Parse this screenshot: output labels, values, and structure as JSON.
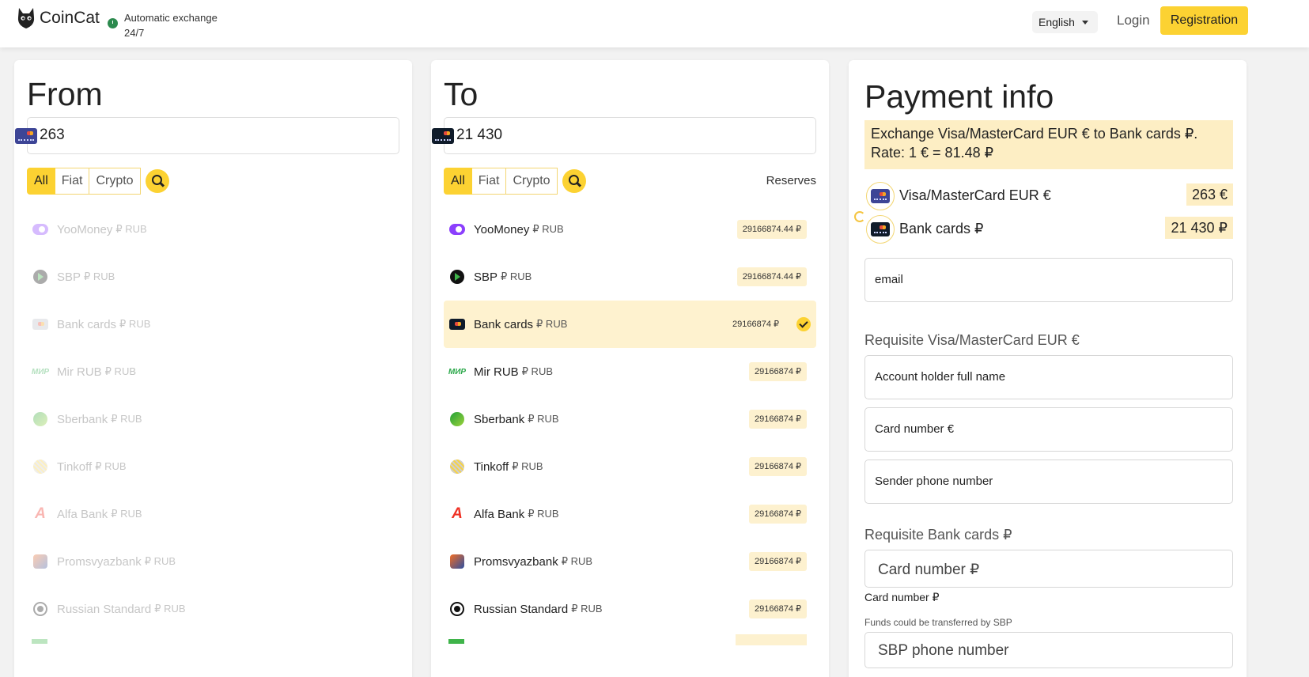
{
  "header": {
    "logo_text": "CoinCat",
    "tagline_line1": "Automatic exchange",
    "tagline_line2": "24/7",
    "language": "English",
    "login": "Login",
    "registration": "Registration"
  },
  "from": {
    "title": "From",
    "amount": "263",
    "filters": [
      "All",
      "Fiat",
      "Crypto"
    ],
    "active_filter": "All",
    "items": [
      {
        "name": "YooMoney",
        "currency": "₽ RUB",
        "icon": "yoomoney-icon"
      },
      {
        "name": "SBP",
        "currency": "₽ RUB",
        "icon": "sbp-icon"
      },
      {
        "name": "Bank cards",
        "currency": "₽ RUB",
        "icon": "bank-card-icon"
      },
      {
        "name": "Mir RUB",
        "currency": "₽ RUB",
        "icon": "mir-icon"
      },
      {
        "name": "Sberbank",
        "currency": "₽ RUB",
        "icon": "sberbank-icon"
      },
      {
        "name": "Tinkoff",
        "currency": "₽ RUB",
        "icon": "tinkoff-icon"
      },
      {
        "name": "Alfa Bank",
        "currency": "₽ RUB",
        "icon": "alfa-bank-icon"
      },
      {
        "name": "Promsvyazbank",
        "currency": "₽ RUB",
        "icon": "promsvyazbank-icon"
      },
      {
        "name": "Russian Standard",
        "currency": "₽ RUB",
        "icon": "russian-standard-icon"
      }
    ]
  },
  "to": {
    "title": "To",
    "amount": "21 430",
    "filters": [
      "All",
      "Fiat",
      "Crypto"
    ],
    "active_filter": "All",
    "reserves_label": "Reserves",
    "items": [
      {
        "name": "YooMoney",
        "currency": "₽ RUB",
        "reserve": "29166874.44 ₽",
        "icon": "yoomoney-icon"
      },
      {
        "name": "SBP",
        "currency": "₽ RUB",
        "reserve": "29166874.44 ₽",
        "icon": "sbp-icon"
      },
      {
        "name": "Bank cards",
        "currency": "₽ RUB",
        "reserve": "29166874 ₽",
        "icon": "bank-card-icon",
        "selected": true
      },
      {
        "name": "Mir RUB",
        "currency": "₽ RUB",
        "reserve": "29166874 ₽",
        "icon": "mir-icon"
      },
      {
        "name": "Sberbank",
        "currency": "₽ RUB",
        "reserve": "29166874 ₽",
        "icon": "sberbank-icon"
      },
      {
        "name": "Tinkoff",
        "currency": "₽ RUB",
        "reserve": "29166874 ₽",
        "icon": "tinkoff-icon"
      },
      {
        "name": "Alfa Bank",
        "currency": "₽ RUB",
        "reserve": "29166874 ₽",
        "icon": "alfa-bank-icon"
      },
      {
        "name": "Promsvyazbank",
        "currency": "₽ RUB",
        "reserve": "29166874 ₽",
        "icon": "promsvyazbank-icon"
      },
      {
        "name": "Russian Standard",
        "currency": "₽ RUB",
        "reserve": "29166874 ₽",
        "icon": "russian-standard-icon"
      }
    ]
  },
  "payment": {
    "title": "Payment info",
    "rate_line1": "Exchange Visa/MasterCard EUR € to Bank cards ₽.",
    "rate_line2": "Rate: 1 € = 81.48 ₽",
    "from_name": "Visa/MasterCard EUR €",
    "from_amount": "263 €",
    "to_name": "Bank cards ₽",
    "to_amount": "21 430 ₽",
    "email_placeholder": "email",
    "requisite_from_title": "Requisite Visa/MasterCard EUR €",
    "holder_placeholder": "Account holder full name",
    "card_eur_placeholder": "Card number €",
    "phone_placeholder": "Sender phone number",
    "requisite_to_title": "Requisite Bank cards ₽",
    "card_rub_placeholder": "Card number ₽",
    "card_rub_label": "Card number ₽",
    "sbp_hint": "Funds could be transferred by SBP",
    "sbp_placeholder": "SBP phone number"
  },
  "colors": {
    "accent": "#fcd232",
    "highlight": "#fef2cf",
    "card_blue": "#3d4596",
    "card_dark": "#0f1b2a"
  }
}
